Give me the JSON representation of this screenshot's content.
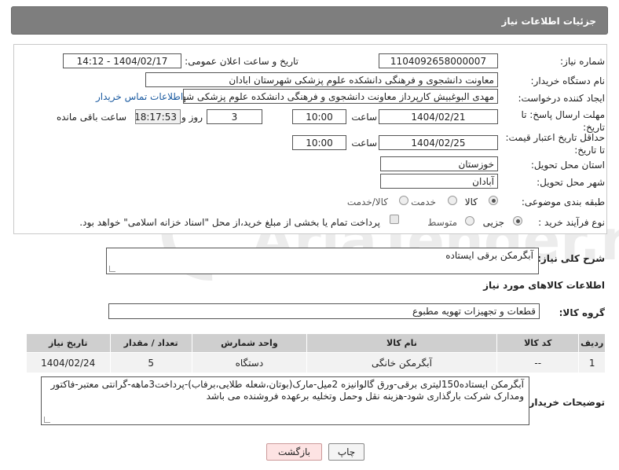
{
  "header": {
    "title": "جزئیات اطلاعات نیاز"
  },
  "form": {
    "need_number_label": "شماره نیاز:",
    "need_number": "1104092658000007",
    "announce_label": "تاریخ و ساعت اعلان عمومی:",
    "announce_value": "1404/02/17 - 14:12",
    "buyer_org_label": "نام دستگاه خریدار:",
    "buyer_org": "معاونت دانشجوی و فرهنگی دانشکده علوم پزشکی شهرستان ابادان",
    "creator_label": "ایجاد کننده درخواست:",
    "creator": "مهدی البوغبیش کارپرداز معاونت دانشجوی و فرهنگی دانشکده علوم پزشکی شهرستان ابادان",
    "contact_link": "اطلاعات تماس خریدار",
    "deadline_label_1": "مهلت ارسال پاسخ: تا",
    "deadline_label_2": "تاریخ:",
    "deadline_date": "1404/02/21",
    "time_label": "ساعت",
    "deadline_time": "10:00",
    "days": "3",
    "days_label": "روز و",
    "remaining_time": "18:17:53",
    "remaining_label": "ساعت باقی مانده",
    "min_price_label_1": "حداقل تاریخ اعتبار قیمت:",
    "min_price_label_2": "تا تاریخ:",
    "price_date": "1404/02/25",
    "price_time": "10:00",
    "province_label": "استان محل تحویل:",
    "province": "خوزستان",
    "city_label": "شهر محل تحویل:",
    "city": "آبادان",
    "category_label": "طبقه بندی موضوعی:",
    "category_options": [
      "کالا",
      "خدمت",
      "کالا/خدمت"
    ],
    "category_selected": "کالا",
    "process_label": "نوع فرآیند خرید :",
    "process_options": [
      "جزیی",
      "متوسط"
    ],
    "process_selected": "جزیی",
    "payment_note": "پرداخت تمام یا بخشی از مبلغ خرید،از محل \"اسناد خزانه اسلامی\" خواهد بود."
  },
  "summary": {
    "label": "شرح کلی نیاز:",
    "value": "آبگرمکن برقی ایستاده"
  },
  "goods": {
    "section_title": "اطلاعات کالاهای مورد نیاز",
    "group_label": "گروه کالا:",
    "group_value": "قطعات و تجهیزات تهویه مطبوع",
    "columns": [
      "ردیف",
      "کد کالا",
      "نام کالا",
      "واحد شمارش",
      "تعداد / مقدار",
      "تاریخ نیاز"
    ],
    "rows": [
      [
        "1",
        "--",
        "آبگرمکن خانگی",
        "دستگاه",
        "5",
        "1404/02/24"
      ]
    ]
  },
  "buyer_notes": {
    "label": "توضیحات خریدار:",
    "value": "آبگرمکن ایستاده150لیتری برقی-ورق گالوانیزه 2میل-مارک(بوتان،شعله طلایی،برفاب)-پرداخت3ماهه-گرانتی معتبر-فاکتور ومدارک شرکت بارگذاری شود-هزینه نقل وحمل وتخلیه برعهده فروشنده می باشد"
  },
  "buttons": {
    "print": "چاپ",
    "back": "بازگشت"
  },
  "watermark": {
    "text": "AriaTender.neT"
  },
  "colors": {
    "header_bg": "#7e7e7e",
    "table_header": "#cfcfcf",
    "link": "#1a5aa0"
  }
}
